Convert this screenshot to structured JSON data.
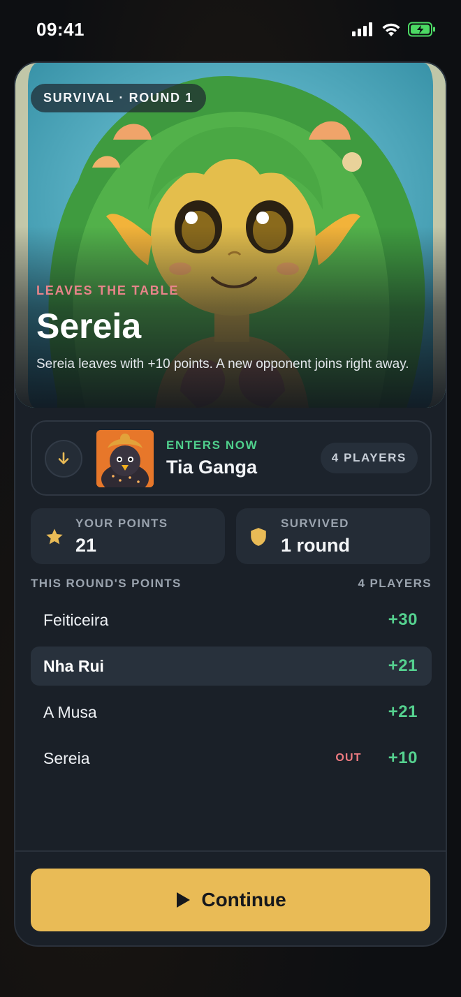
{
  "status_bar": {
    "time": "09:41"
  },
  "hero": {
    "mode_chip": "SURVIVAL · ROUND 1",
    "leaves_label": "LEAVES THE TABLE",
    "name": "Sereia",
    "description": "Sereia leaves with +10 points. A new opponent joins right away."
  },
  "entering": {
    "label": "ENTERS NOW",
    "name": "Tia Ganga",
    "players_badge": "4 PLAYERS"
  },
  "stats": {
    "points_label": "YOUR POINTS",
    "points_value": "21",
    "survived_label": "SURVIVED",
    "survived_value": "1 round"
  },
  "scores": {
    "header_left": "THIS ROUND'S POINTS",
    "header_right": "4 PLAYERS",
    "rows": [
      {
        "name": "Feiticeira",
        "points": "+30",
        "tag": ""
      },
      {
        "name": "Nha Rui",
        "points": "+21",
        "tag": ""
      },
      {
        "name": "A Musa",
        "points": "+21",
        "tag": ""
      },
      {
        "name": "Sereia",
        "points": "+10",
        "tag": "OUT"
      }
    ]
  },
  "continue_label": "Continue",
  "colors": {
    "accent": "#e9bb56",
    "positive": "#55d18f",
    "negative": "#ef7b81",
    "enters": "#4fcf8c"
  },
  "icons": [
    "signal-icon",
    "wifi-icon",
    "battery-charging-icon",
    "arrow-down-icon",
    "star-icon",
    "shield-icon",
    "play-icon"
  ]
}
